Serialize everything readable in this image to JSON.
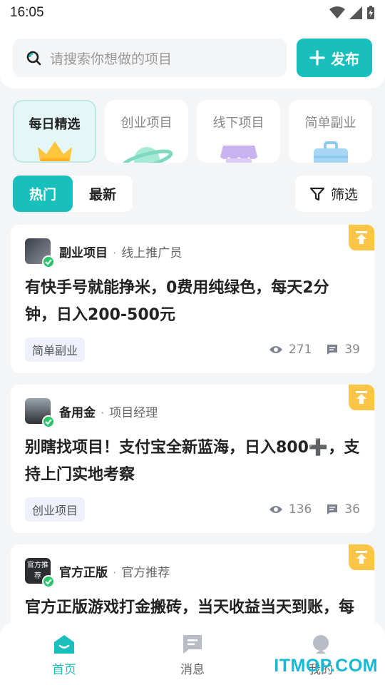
{
  "status_bar": {
    "time": "16:05"
  },
  "search": {
    "placeholder": "请搜索你想做的项目"
  },
  "publish_label": "发布",
  "categories": [
    {
      "label": "每日精选",
      "icon": "crown-icon",
      "active": true
    },
    {
      "label": "创业项目",
      "icon": "planet-icon",
      "active": false
    },
    {
      "label": "线下项目",
      "icon": "shop-awning-icon",
      "active": false
    },
    {
      "label": "简单副业",
      "icon": "briefcase-icon",
      "active": false
    }
  ],
  "tabs": [
    {
      "label": "热门",
      "active": true
    },
    {
      "label": "最新",
      "active": false
    }
  ],
  "filter_label": "筛选",
  "posts": [
    {
      "author": "副业项目",
      "role": "线上推广员",
      "title": "有快手号就能挣米，0费用纯绿色，每天2分钟，日入200-500元",
      "tag": "简单副业",
      "views": "271",
      "comments": "39",
      "pinned": true
    },
    {
      "author": "备用金",
      "role": "项目经理",
      "title": "别瞎找项目！支付宝全新蓝海，日入800➕，支持上门实地考察",
      "tag": "创业项目",
      "views": "136",
      "comments": "36",
      "pinned": true
    },
    {
      "author": "官方正版",
      "role": "官方推荐",
      "avatar_text": "官方推荐",
      "title": "官方正版游戏打金搬砖，当天收益当天到账，每天稳定收益",
      "pinned": true
    }
  ],
  "bottom_nav": [
    {
      "label": "首页",
      "icon": "home-icon",
      "active": true
    },
    {
      "label": "消息",
      "icon": "message-icon",
      "active": false
    },
    {
      "label": "我的",
      "icon": "profile-icon",
      "active": false
    }
  ],
  "watermark": "ITMOP.COM",
  "colors": {
    "accent": "#19bfbd",
    "pin": "#fcc545",
    "verified": "#2cc66d"
  }
}
